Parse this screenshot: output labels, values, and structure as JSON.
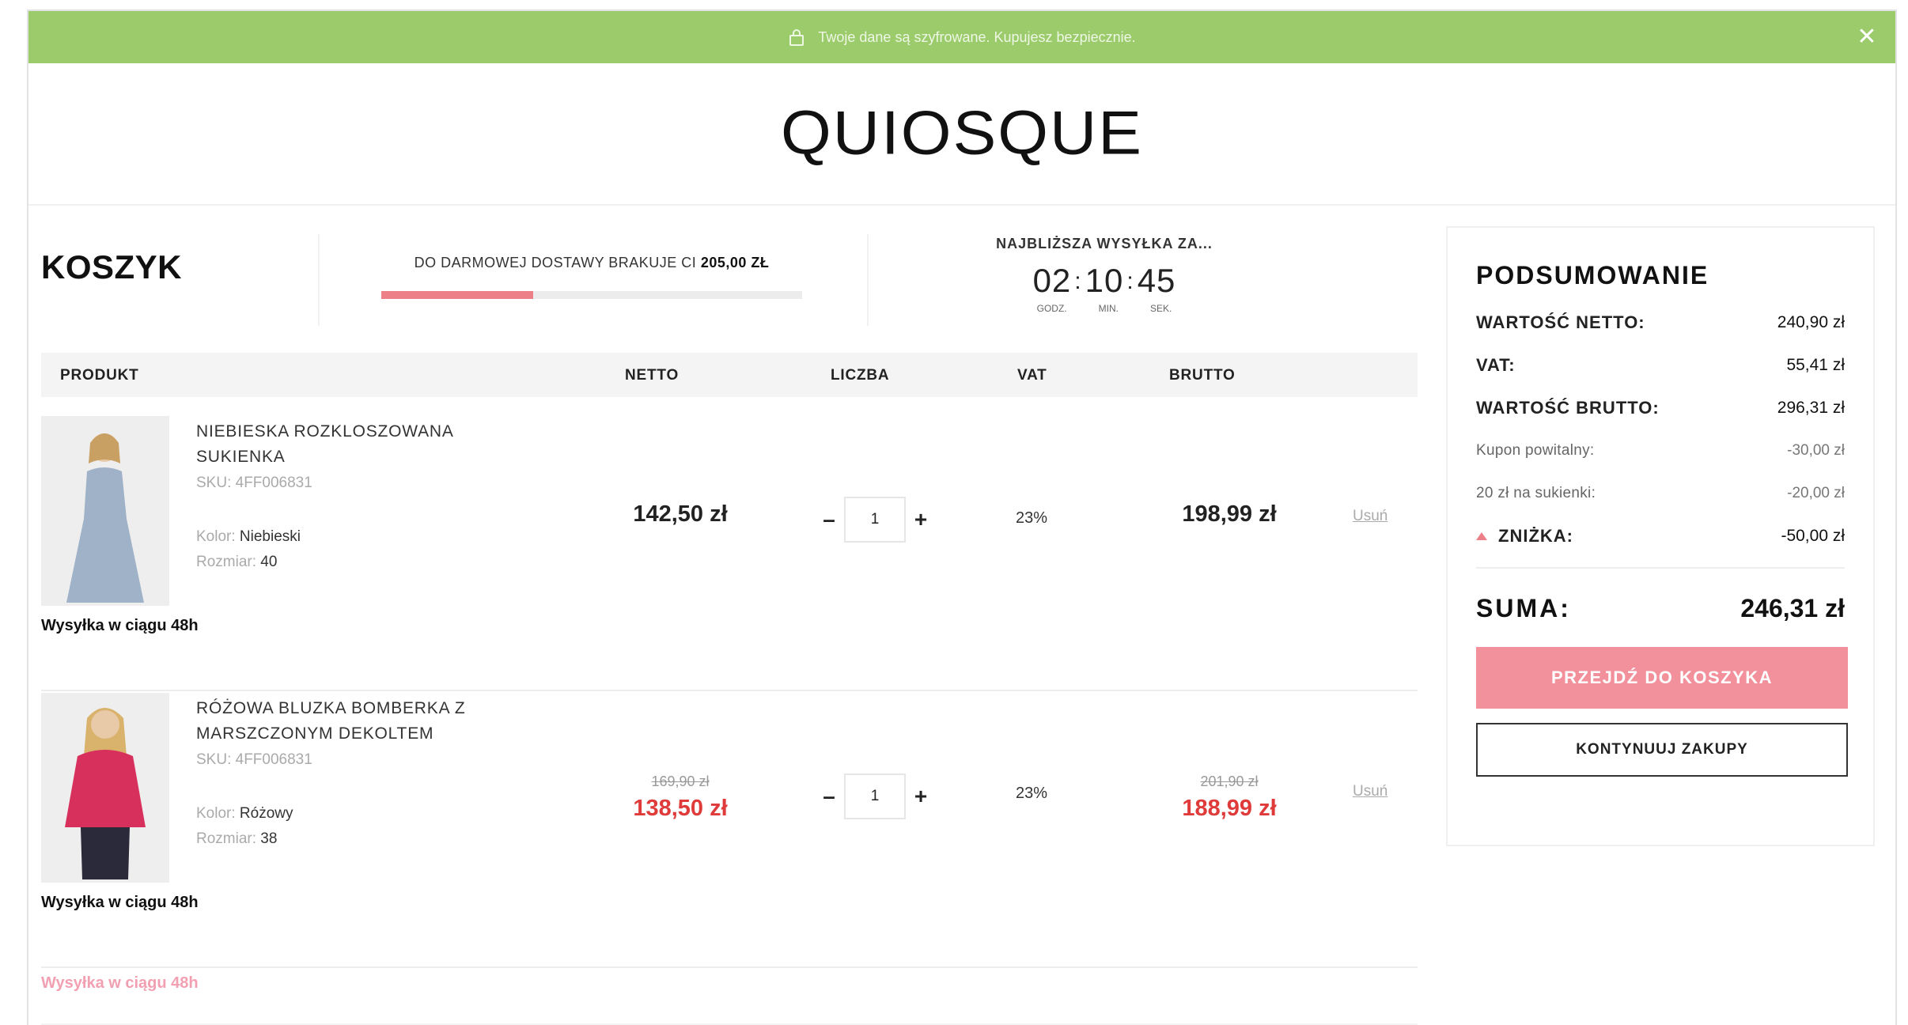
{
  "banner": {
    "text": "Twoje dane są szyfrowane. Kupujesz bezpiecznie."
  },
  "brand": {
    "logo": "QUIOSQUE"
  },
  "cart": {
    "title": "KOSZYK",
    "free_shipping": {
      "prefix": "DO DARMOWEJ DOSTAWY BRAKUJE CI",
      "amount": "205,00 ZŁ",
      "progress_fraction": 0.36
    },
    "countdown": {
      "label": "NAJBLIŻSZA WYSYŁKA ZA...",
      "hours": "02",
      "minutes": "10",
      "seconds": "45",
      "unit_hours": "GODZ.",
      "unit_minutes": "MIN.",
      "unit_seconds": "SEK."
    },
    "columns": {
      "product": "PRODUKT",
      "netto": "NETTO",
      "qty": "LICZBA",
      "vat": "VAT",
      "brutto": "BRUTTO"
    },
    "items": [
      {
        "name": "NIEBIESKA ROZKLOSZOWANA SUKIENKA",
        "sku": "SKU: 4FF006831",
        "color_label": "Kolor:",
        "color": "Niebieski",
        "size_label": "Rozmiar:",
        "size": "40",
        "shipping": "Wysyłka w ciągu 48h",
        "netto": "142,50 zł",
        "qty": "1",
        "vat": "23%",
        "brutto": "198,99 zł",
        "remove": "Usuń",
        "image_color": "#9fb2c8"
      },
      {
        "name": "RÓŻOWA BLUZKA BOMBERKA Z MARSZCZONYM DEKOLTEM",
        "sku": "SKU: 4FF006831",
        "color_label": "Kolor:",
        "color": "Różowy",
        "size_label": "Rozmiar:",
        "size": "38",
        "shipping": "Wysyłka w ciągu 48h",
        "netto_old": "169,90 zł",
        "netto": "138,50 zł",
        "qty": "1",
        "vat": "23%",
        "brutto_old": "201,90 zł",
        "brutto": "188,99 zł",
        "remove": "Usuń",
        "image_color": "#d8305c"
      }
    ],
    "extra_shipping": "Wysyłka w ciągu 48h"
  },
  "summary": {
    "title": "PODSUMOWANIE",
    "netto_label": "WARTOŚĆ NETTO:",
    "netto": "240,90 zł",
    "vat_label": "VAT:",
    "vat": "55,41 zł",
    "brutto_label": "WARTOŚĆ BRUTTO:",
    "brutto": "296,31 zł",
    "coupon_label": "Kupon powitalny:",
    "coupon": "-30,00 zł",
    "dress_label": "20 zł na sukienki:",
    "dress": "-20,00 zł",
    "discount_label": "ZNIŻKA:",
    "discount": "-50,00 zł",
    "total_label": "SUMA:",
    "total": "246,31 zł",
    "checkout_button": "PRZEJDŹ DO KOSZYKA",
    "continue_button": "KONTYNUUJ ZAKUPY"
  },
  "colors": {
    "banner": "#9ccb6c",
    "accent_pink": "#f2909b",
    "sale_red": "#e03b3b"
  }
}
